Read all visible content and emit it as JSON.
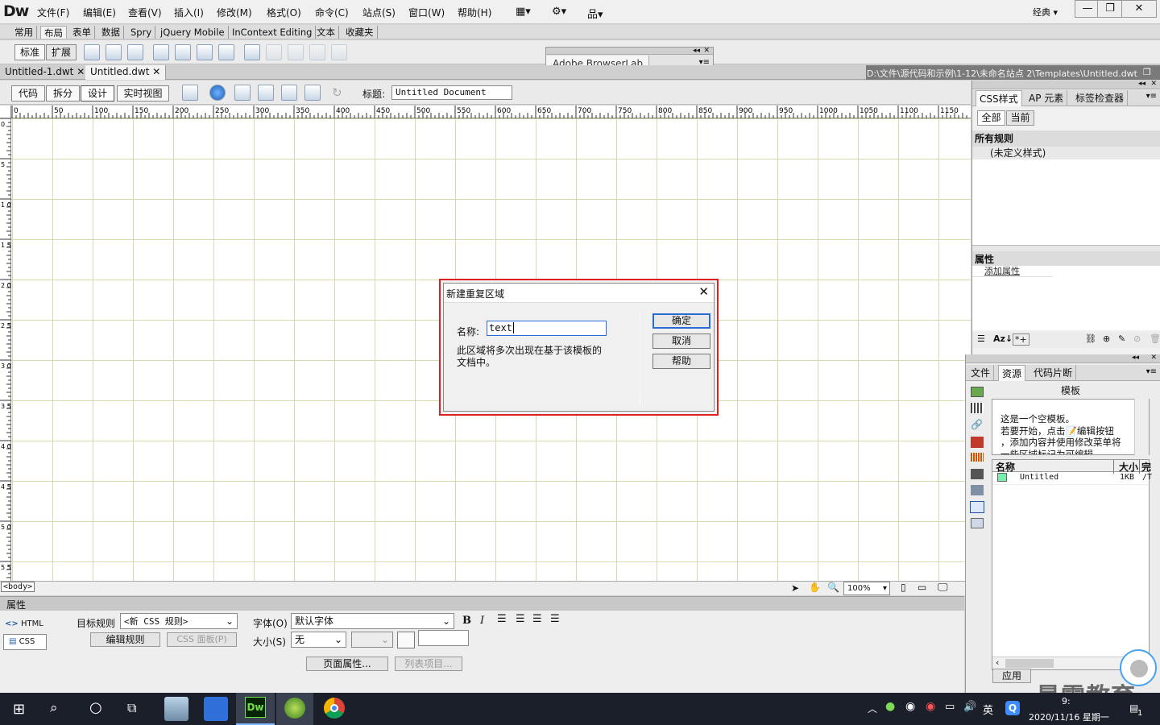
{
  "app": {
    "logo": "Dw",
    "workspace": "经典"
  },
  "menu": [
    "文件(F)",
    "编辑(E)",
    "查看(V)",
    "插入(I)",
    "修改(M)",
    "格式(O)",
    "命令(C)",
    "站点(S)",
    "窗口(W)",
    "帮助(H)"
  ],
  "insert_tabs": [
    "常用",
    "布局",
    "表单",
    "数据",
    "Spry",
    "jQuery Mobile",
    "InContext Editing",
    "文本",
    "收藏夹"
  ],
  "layout_mode": {
    "standard": "标准",
    "expanded": "扩展"
  },
  "doc_tabs": [
    "Untitled-1.dwt",
    "Untitled.dwt"
  ],
  "doc_path": "D:\\文件\\源代码和示例\\1-12\\未命名站点 2\\Templates\\Untitled.dwt",
  "view_buttons": {
    "code": "代码",
    "split": "拆分",
    "design": "设计",
    "live": "实时视图"
  },
  "title_label": "标题:",
  "title_value": "Untitled Document",
  "ruler": [
    "0",
    "50",
    "100",
    "150",
    "200",
    "250",
    "300",
    "350",
    "400",
    "450",
    "500",
    "550",
    "600",
    "650",
    "700",
    "750",
    "800",
    "850",
    "900",
    "950",
    "1000",
    "1050",
    "1100",
    "1150"
  ],
  "ruler_v": [
    "0",
    "5",
    "1 0",
    "1 5",
    "2 0",
    "2 5",
    "3 0",
    "3 5",
    "4 0",
    "4 5",
    "5 0",
    "5 5",
    "6 0",
    "6 5"
  ],
  "statusbar": {
    "tag": "<body>",
    "zoom": "100%"
  },
  "browserlab": "Adobe BrowserLab",
  "dialog": {
    "title": "新建重复区域",
    "name_label": "名称:",
    "name_value": "text",
    "desc": "此区域将多次出现在基于该模板的文档中。",
    "ok": "确定",
    "cancel": "取消",
    "help": "帮助"
  },
  "properties": {
    "panel_title": "属性",
    "html": "HTML",
    "css": "CSS",
    "target_rule_label": "目标规则",
    "target_rule_value": "<新 CSS 规则>",
    "edit_rule": "编辑规则",
    "css_panel": "CSS 面板(P)",
    "font_label": "字体(O)",
    "font_value": "默认字体",
    "size_label": "大小(S)",
    "size_value": "无",
    "page_props": "页面属性...",
    "list_items": "列表项目..."
  },
  "css_panel": {
    "tabs": [
      "CSS样式",
      "AP 元素",
      "标签检查器"
    ],
    "modes": [
      "全部",
      "当前"
    ],
    "all_rules": "所有规则",
    "undefined": "(未定义样式)",
    "props_title": "属性",
    "add_prop": "添加属性"
  },
  "files_panel": {
    "tabs": [
      "文件",
      "资源",
      "代码片断"
    ],
    "section": "模板",
    "preview_lines": [
      "这是一个空模板。",
      "若要开始，点击",
      "编辑按钮",
      "，添加内容并使用修改菜单将",
      "一些区域标记为可编辑。"
    ],
    "col_name": "名称",
    "col_size": "大小",
    "col_extra": "完",
    "file_name": "Untitled",
    "file_size": "1KB",
    "file_extra": "/T",
    "apply": "应用"
  },
  "taskbar": {
    "ime": "英",
    "time": "9:",
    "date": "2020/11/16 星期一",
    "badge": "1"
  },
  "watermark": "最需教育"
}
